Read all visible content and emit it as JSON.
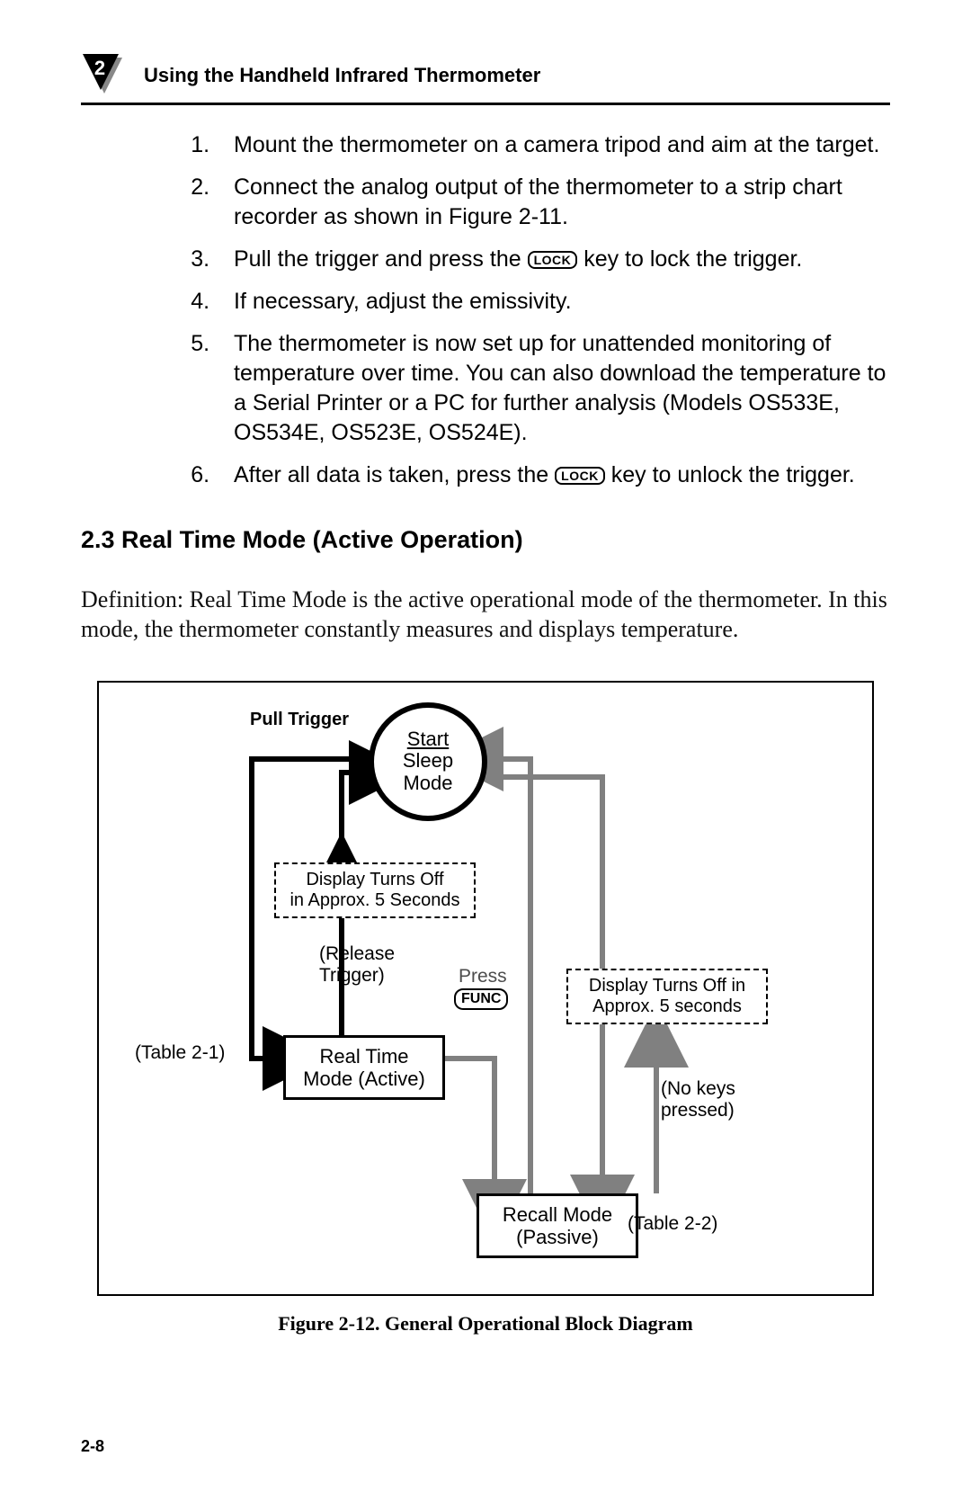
{
  "header": {
    "chapter_number": "2",
    "chapter_title": "Using the Handheld Infrared Thermometer"
  },
  "steps": {
    "s1": "Mount the thermometer on a camera tripod and aim at the target.",
    "s2": "Connect the analog output of the thermometer to a strip chart recorder as shown in Figure 2-11.",
    "s3a": "Pull the trigger and press the ",
    "s3b": " key to lock the trigger.",
    "s4": "If necessary, adjust the emissivity.",
    "s5": "The thermometer is now set up for unattended monitoring of temperature over time. You can also download the temperature to a Serial Printer or a PC for further analysis (Models OS533E, OS534E, OS523E, OS524E).",
    "s6a": "After all data is taken, press the ",
    "s6b": " key to unlock the trigger.",
    "lock_label": "LOCK"
  },
  "section": {
    "heading": "2.3  Real Time Mode (Active Operation)",
    "definition": "Definition:  Real Time Mode is the active operational mode of the thermometer. In this mode, the thermometer constantly measures and displays temperature."
  },
  "diagram": {
    "pull_trigger": "Pull Trigger",
    "start": "Start",
    "sleep_mode": "Sleep\nMode",
    "display_off_1": "Display Turns Off\nin Approx. 5 Seconds",
    "release_trigger": "(Release\nTrigger)",
    "press": "Press",
    "func": "FUNC",
    "real_time": "Real Time\nMode (Active)",
    "table21": "(Table 2-1)",
    "display_off_2": "Display Turns Off in\nApprox. 5 seconds",
    "no_keys": "(No keys\npressed)",
    "recall_mode": "Recall Mode\n(Passive)",
    "table22": "(Table 2-2)"
  },
  "figure_caption": "Figure 2-12.  General Operational Block Diagram",
  "page_number": "2-8"
}
